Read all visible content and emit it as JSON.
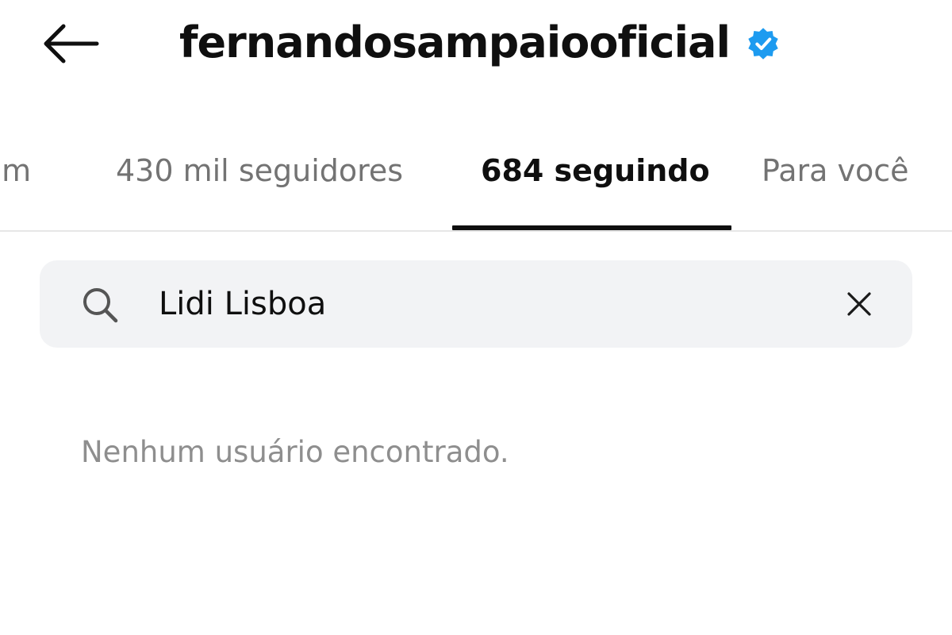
{
  "header": {
    "username": "fernandosampaiooficial",
    "back_icon": "arrow-left-icon",
    "verified_icon": "verified-badge-icon",
    "verified_color": "#1d9bf0"
  },
  "tabs": [
    {
      "label": "um",
      "active": false
    },
    {
      "label": "430 mil seguidores",
      "active": false
    },
    {
      "label": "684 seguindo",
      "active": true
    },
    {
      "label": "Para você",
      "active": false
    }
  ],
  "search": {
    "icon": "search-icon",
    "value": "Lidi Lisboa",
    "clear_icon": "close-icon"
  },
  "results": {
    "empty_message": "Nenhum usuário encontrado."
  }
}
